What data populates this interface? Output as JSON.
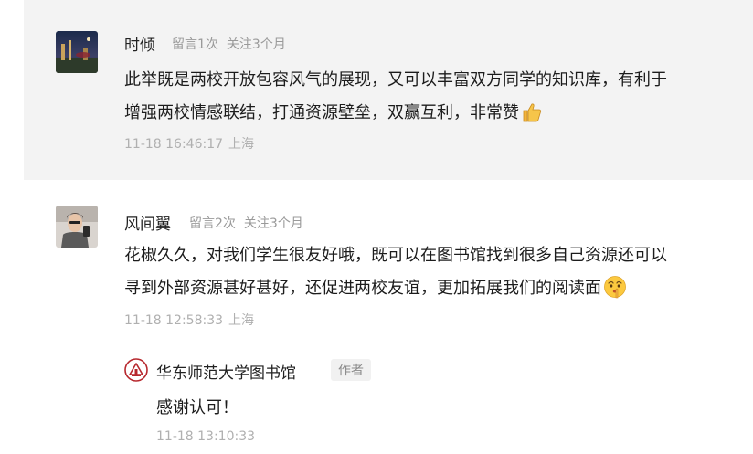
{
  "comments": [
    {
      "name": "时倾",
      "comment_count": "留言1次",
      "follow_duration": "关注3个月",
      "content_lines": [
        "此举既是两校开放包容风气的展现，又可以丰富双方同学的知识库，有利于",
        "增强两校情感联结，打通资源壁垒，双赢互利，非常赞"
      ],
      "emoji": "thumbs-up-emoji",
      "date": "11-18 16:46:17",
      "location": "上海"
    },
    {
      "name": "风间翼",
      "comment_count": "留言2次",
      "follow_duration": "关注3个月",
      "content_lines": [
        "花椒久久，对我们学生很友好哦，既可以在图书馆找到很多自己资源还可以",
        "寻到外部资源甚好甚好，还促进两校友谊，更加拓展我们的阅读面"
      ],
      "emoji": "shushing-face-emoji",
      "date": "11-18 12:58:33",
      "location": "上海",
      "reply": {
        "name": "华东师范大学图书馆",
        "badge": "作者",
        "content": "感谢认可！",
        "date": "11-18 13:10:33"
      }
    }
  ],
  "colors": {
    "highlight_background": "#f3f3f3",
    "meta_text": "#9a9a9a",
    "time_text": "#b0b0b0",
    "logo_red": "#b7282e"
  }
}
